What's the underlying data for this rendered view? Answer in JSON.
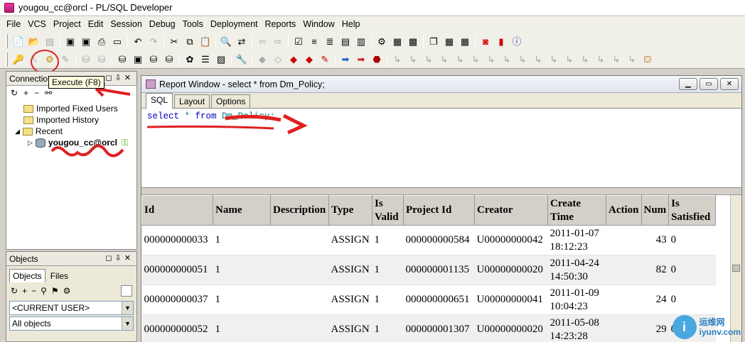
{
  "titlebar": {
    "title": "yougou_cc@orcl - PL/SQL Developer"
  },
  "menu": [
    "File",
    "VCS",
    "Project",
    "Edit",
    "Session",
    "Debug",
    "Tools",
    "Deployment",
    "Reports",
    "Window",
    "Help"
  ],
  "tooltip": "Execute (F8)",
  "connections": {
    "title": "Connectio",
    "items": [
      "Imported Fixed Users",
      "Imported History",
      "Recent",
      "yougou_cc@orcl"
    ]
  },
  "objects": {
    "title": "Objects",
    "tabs": [
      "Objects",
      "Files"
    ],
    "user_combo": "<CURRENT USER>",
    "filter_combo": "All objects"
  },
  "report": {
    "title": "Report Window - select * from Dm_Policy;",
    "tabs": [
      "SQL",
      "Layout",
      "Options"
    ],
    "sql": {
      "kw1": "select",
      "star": " * ",
      "kw2": "from",
      "rest": " Dm_Policy;"
    }
  },
  "grid": {
    "headers": [
      "Id",
      "Name",
      "Description",
      "Type",
      "Is Valid",
      "Project Id",
      "Creator",
      "Create Time",
      "Action",
      "Num",
      "Is Satisfied"
    ],
    "rows": [
      [
        "000000000033",
        "1",
        "",
        "ASSIGN",
        "1",
        "000000000584",
        "U00000000042",
        "2011-01-07 18:12:23",
        "",
        "43",
        "0"
      ],
      [
        "000000000051",
        "1",
        "",
        "ASSIGN",
        "1",
        "000000001135",
        "U00000000020",
        "2011-04-24 14:50:30",
        "",
        "82",
        "0"
      ],
      [
        "000000000037",
        "1",
        "",
        "ASSIGN",
        "1",
        "000000000651",
        "U00000000041",
        "2011-01-09 10:04:23",
        "",
        "24",
        "0"
      ],
      [
        "000000000052",
        "1",
        "",
        "ASSIGN",
        "1",
        "000000001307",
        "U00000000020",
        "2011-05-08 14:23:28",
        "",
        "29",
        "0"
      ]
    ]
  },
  "watermark": {
    "cn": "运维网",
    "en": "iyunv.com"
  },
  "colors": {
    "accent": "#e02020",
    "sql_text": "#008080",
    "sql_keyword": "#0000c0"
  }
}
